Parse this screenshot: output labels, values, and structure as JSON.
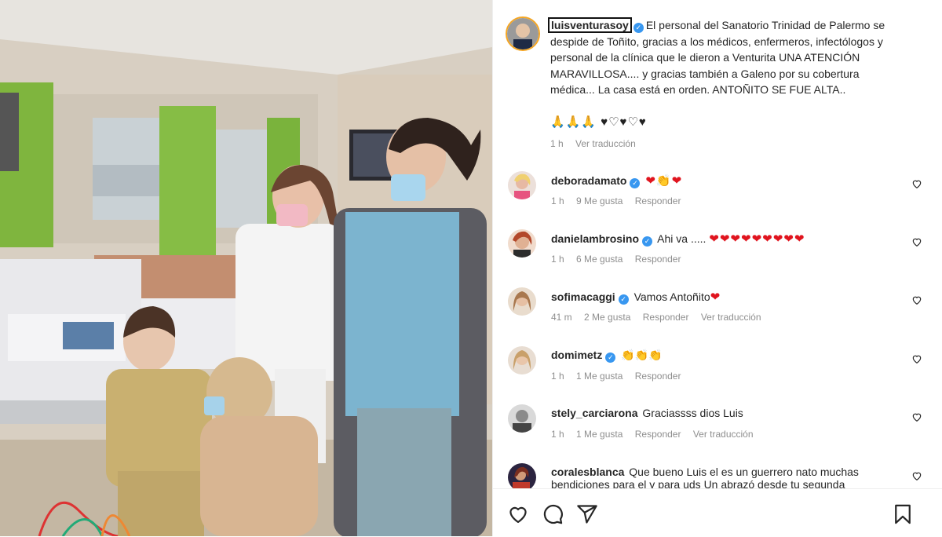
{
  "post": {
    "username": "luisventurasoy",
    "caption": "El personal del Sanatorio Trinidad de Palermo se despide de Toñito, gracias a los médicos, enfermeros, infectólogos y personal de la clínica que le dieron a Venturita UNA ATENCIÓN MARAVILLOSA.... y gracias también a Galeno por su cobertura médica... La casa está en orden. ANTOÑITO SE FUE ALTA..",
    "emojis": "🙏🙏🙏 ♥♡♥♡♥",
    "time": "1 h",
    "translate": "Ver traducción"
  },
  "comments": [
    {
      "username": "deboradamato",
      "verified": true,
      "text": "",
      "emoji": "❤👏❤",
      "time": "1 h",
      "likes": "9 Me gusta",
      "reply": "Responder",
      "translate": "",
      "avatar_color": "#e6b8b8"
    },
    {
      "username": "danielambrosino",
      "verified": true,
      "text": "Ahi va .....",
      "emoji": "❤❤❤❤❤❤❤❤❤",
      "time": "1 h",
      "likes": "6 Me gusta",
      "reply": "Responder",
      "translate": "",
      "avatar_color": "#d7a27a"
    },
    {
      "username": "sofimacaggi",
      "verified": true,
      "text": "Vamos Antoñito",
      "emoji": "❤",
      "time": "41 m",
      "likes": "2 Me gusta",
      "reply": "Responder",
      "translate": "Ver traducción",
      "avatar_color": "#c9a98b"
    },
    {
      "username": "domimetz",
      "verified": true,
      "text": "",
      "emoji": "👏👏👏",
      "time": "1 h",
      "likes": "1 Me gusta",
      "reply": "Responder",
      "translate": "",
      "avatar_color": "#b8946b"
    },
    {
      "username": "stely_carciarona",
      "verified": false,
      "text": "Graciassss dios Luis",
      "emoji": "",
      "time": "1 h",
      "likes": "1 Me gusta",
      "reply": "Responder",
      "translate": "Ver traducción",
      "avatar_color": "#777777"
    },
    {
      "username": "coralesblanca",
      "verified": false,
      "text": "Que bueno Luis el es un guerrero nato muchas bendiciones para el y para uds Un abrazó desde tu segunda",
      "emoji": "",
      "time": "",
      "likes": "",
      "reply": "",
      "translate": "",
      "avatar_color": "#4a3a6b"
    }
  ],
  "icons": {
    "like": "heart-icon",
    "comment": "comment-icon",
    "share": "send-icon",
    "save": "bookmark-icon",
    "verified": "verified-badge-icon"
  },
  "colors": {
    "verified": "#3897f0",
    "heart": "#e0141e",
    "muted": "#8e8e8e",
    "text": "#262626"
  }
}
